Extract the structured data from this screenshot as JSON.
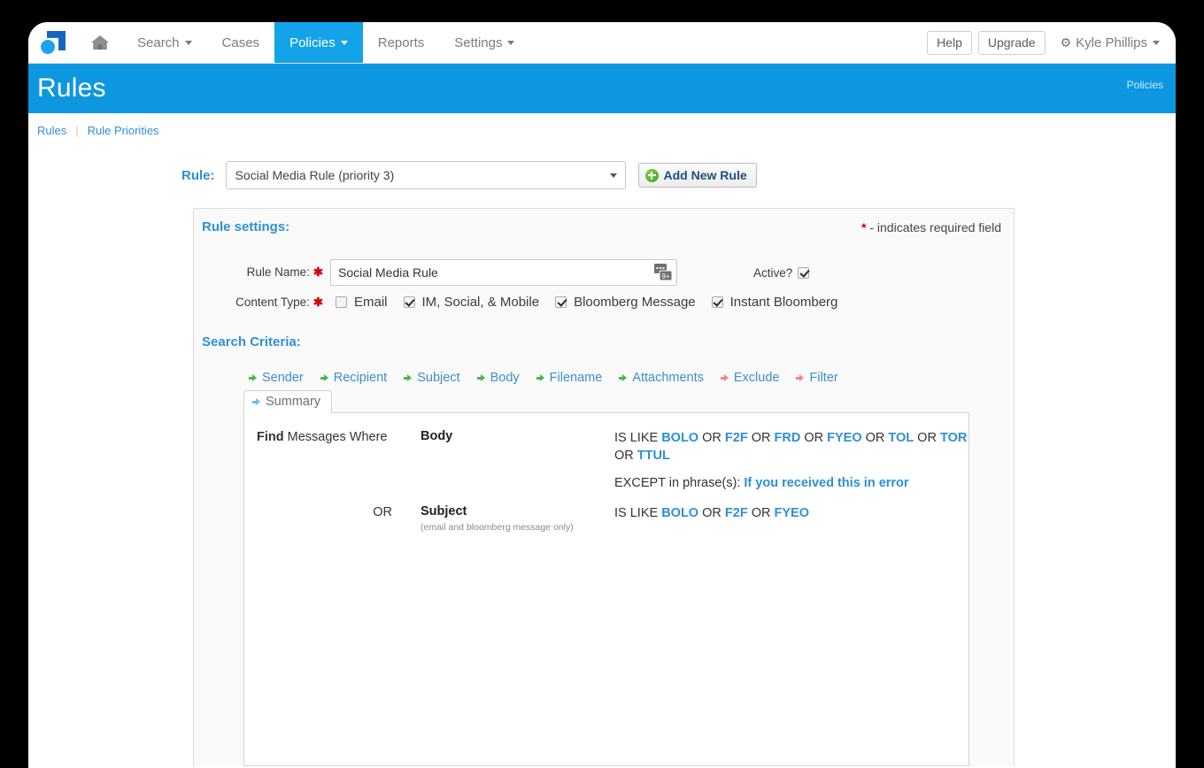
{
  "navbar": {
    "logo_name": "app-logo",
    "home_icon": "home-icon",
    "items": [
      {
        "label": "Search",
        "has_caret": true,
        "active": false
      },
      {
        "label": "Cases",
        "has_caret": false,
        "active": false
      },
      {
        "label": "Policies",
        "has_caret": true,
        "active": true
      },
      {
        "label": "Reports",
        "has_caret": false,
        "active": false
      },
      {
        "label": "Settings",
        "has_caret": true,
        "active": false
      }
    ],
    "help_label": "Help",
    "upgrade_label": "Upgrade",
    "user_name": "Kyle Phillips"
  },
  "banner": {
    "title": "Rules",
    "right_link": "Policies",
    "color": "#0d97e0"
  },
  "breadcrumb": {
    "first": "Rules",
    "separator": "|",
    "second": "Rule Priorities"
  },
  "rule_selector": {
    "label": "Rule:",
    "selected": "Social Media Rule (priority 3)",
    "add_button": "Add New Rule"
  },
  "rule_settings": {
    "heading": "Rule settings:",
    "required_star": "*",
    "required_note": " - indicates required field",
    "rule_name_label": "Rule Name:",
    "rule_name_value": "Social Media Rule",
    "active_label": "Active?",
    "active_checked": true,
    "content_type_label": "Content Type:",
    "content_types": [
      {
        "label": "Email",
        "checked": false
      },
      {
        "label": "IM, Social, & Mobile",
        "checked": true
      },
      {
        "label": "Bloomberg Message",
        "checked": true
      },
      {
        "label": "Instant Bloomberg",
        "checked": true
      }
    ]
  },
  "search_criteria": {
    "heading": "Search Criteria:",
    "tabs": [
      {
        "label": "Sender",
        "arrow": "green"
      },
      {
        "label": "Recipient",
        "arrow": "green"
      },
      {
        "label": "Subject",
        "arrow": "green"
      },
      {
        "label": "Body",
        "arrow": "green"
      },
      {
        "label": "Filename",
        "arrow": "green"
      },
      {
        "label": "Attachments",
        "arrow": "green"
      },
      {
        "label": "Exclude",
        "arrow": "red"
      },
      {
        "label": "Filter",
        "arrow": "red"
      }
    ],
    "active_tab": "Summary"
  },
  "summary": {
    "row1": {
      "prefix_strong": "Find",
      "prefix_rest": " Messages Where",
      "field": "Body",
      "condition_prefix": "IS LIKE ",
      "terms": [
        "BOLO",
        "F2F",
        "FRD",
        "FYEO",
        "TOL",
        "TOR",
        "TTUL"
      ],
      "joiner": "OR",
      "except_label": "EXCEPT in phrase(s): ",
      "except_value": "If you received this in error"
    },
    "row2": {
      "prefix": "OR",
      "field": "Subject",
      "note": "(email and bloomberg message only)",
      "condition_prefix": "IS LIKE ",
      "terms": [
        "BOLO",
        "F2F",
        "FYEO"
      ],
      "joiner": "OR"
    }
  }
}
